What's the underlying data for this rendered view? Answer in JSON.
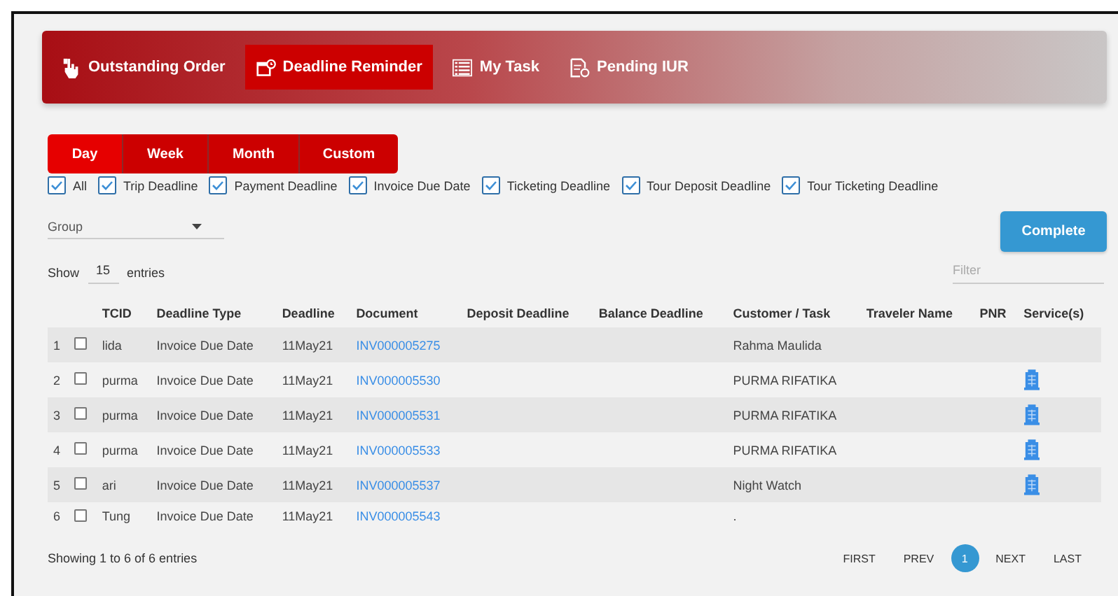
{
  "nav_tabs": [
    {
      "label": "Outstanding Order",
      "selected": false
    },
    {
      "label": "Deadline Reminder",
      "selected": true
    },
    {
      "label": "My Task",
      "selected": false
    },
    {
      "label": "Pending IUR",
      "selected": false
    }
  ],
  "periods": [
    {
      "label": "Day",
      "selected": true
    },
    {
      "label": "Week",
      "selected": false
    },
    {
      "label": "Month",
      "selected": false
    },
    {
      "label": "Custom",
      "selected": false
    }
  ],
  "deadline_filters": [
    {
      "label": "All",
      "checked": true
    },
    {
      "label": "Trip Deadline",
      "checked": true
    },
    {
      "label": "Payment Deadline",
      "checked": true
    },
    {
      "label": "Invoice Due Date",
      "checked": true
    },
    {
      "label": "Ticketing Deadline",
      "checked": true
    },
    {
      "label": "Tour Deposit Deadline",
      "checked": true
    },
    {
      "label": "Tour Ticketing Deadline",
      "checked": true
    }
  ],
  "group_select": {
    "value": "Group"
  },
  "complete_button": "Complete",
  "entries": {
    "prefix": "Show",
    "value": "15",
    "suffix": "entries"
  },
  "filter": {
    "placeholder": "Filter"
  },
  "table": {
    "columns": [
      "TCID",
      "Deadline Type",
      "Deadline",
      "Document",
      "Deposit Deadline",
      "Balance Deadline",
      "Customer / Task",
      "Traveler Name",
      "PNR",
      "Service(s)"
    ],
    "rows": [
      {
        "index": "1",
        "checked": false,
        "tcid": "lida",
        "deadline_type": "Invoice Due Date",
        "deadline": "11May21",
        "document": "INV000005275",
        "customer": "Rahma Maulida"
      },
      {
        "index": "2",
        "checked": false,
        "tcid": "purma",
        "deadline_type": "Invoice Due Date",
        "deadline": "11May21",
        "document": "INV000005530",
        "customer": "PURMA RIFATIKA",
        "services": [
          {
            "kind": "hotel"
          }
        ]
      },
      {
        "index": "3",
        "checked": false,
        "tcid": "purma",
        "deadline_type": "Invoice Due Date",
        "deadline": "11May21",
        "document": "INV000005531",
        "customer": "PURMA RIFATIKA",
        "services": [
          {
            "kind": "hotel"
          }
        ]
      },
      {
        "index": "4",
        "checked": false,
        "tcid": "purma",
        "deadline_type": "Invoice Due Date",
        "deadline": "11May21",
        "document": "INV000005533",
        "customer": "PURMA RIFATIKA",
        "services": [
          {
            "kind": "hotel"
          }
        ]
      },
      {
        "index": "5",
        "checked": false,
        "tcid": "ari",
        "deadline_type": "Invoice Due Date",
        "deadline": "11May21",
        "document": "INV000005537",
        "customer": "Night Watch",
        "services": [
          {
            "kind": "hotel"
          }
        ]
      },
      {
        "index": "6",
        "checked": false,
        "tcid": "Tung",
        "deadline_type": "Invoice Due Date",
        "deadline": "11May21",
        "document": "INV000005543",
        "customer": "."
      }
    ]
  },
  "footer": {
    "summary": "Showing 1 to 6 of 6 entries",
    "pagination": [
      {
        "label": "FIRST",
        "selected": false
      },
      {
        "label": "PREV",
        "selected": false
      },
      {
        "label": "1",
        "selected": true
      },
      {
        "label": "NEXT",
        "selected": false
      },
      {
        "label": "LAST",
        "selected": false
      }
    ]
  }
}
